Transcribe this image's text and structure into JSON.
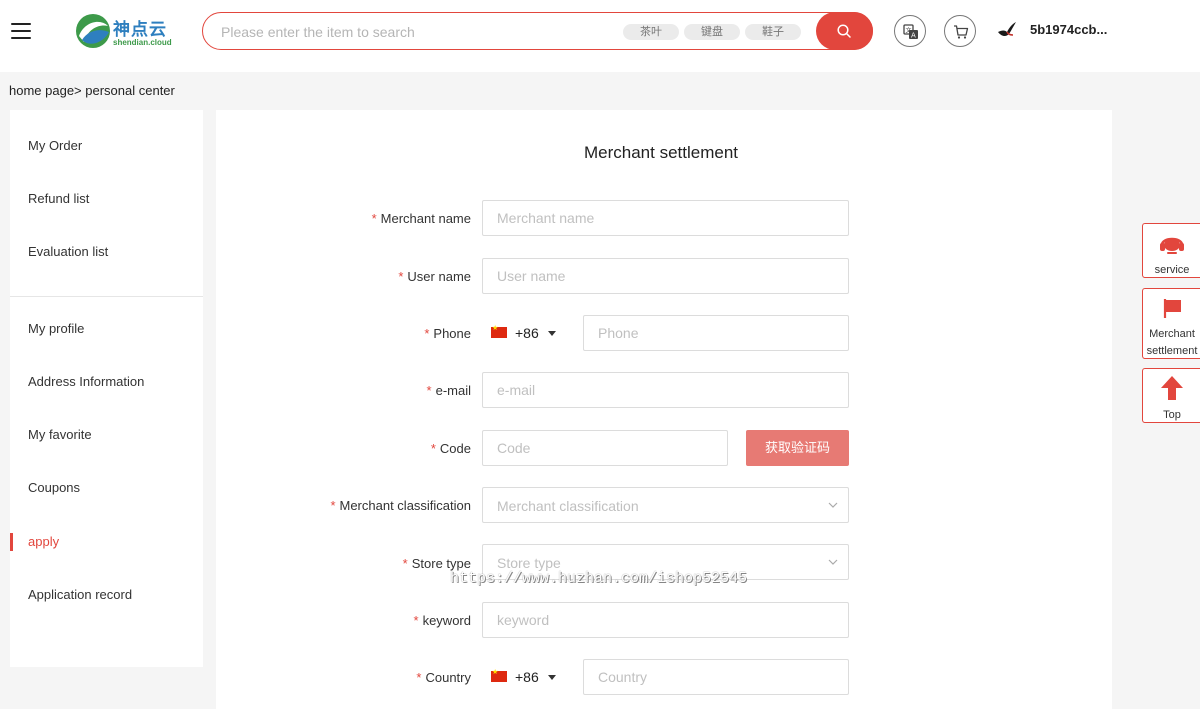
{
  "header": {
    "logo_cn": "神点云",
    "logo_en": "shendian.cloud",
    "search_placeholder": "Please enter the item to search",
    "tags": [
      "茶叶",
      "键盘",
      "鞋子"
    ],
    "username": "5b1974ccb..."
  },
  "breadcrumb": "home page> personal center",
  "sidebar": {
    "items": [
      {
        "label": "My Order"
      },
      {
        "label": "Refund list"
      },
      {
        "label": "Evaluation list"
      },
      {
        "label": "My profile"
      },
      {
        "label": "Address Information"
      },
      {
        "label": "My favorite"
      },
      {
        "label": "Coupons"
      },
      {
        "label": "apply",
        "active": true
      },
      {
        "label": "Application record"
      }
    ]
  },
  "form": {
    "title": "Merchant settlement",
    "required_mark": "*",
    "fields": [
      {
        "label": "Merchant name",
        "placeholder": "Merchant name"
      },
      {
        "label": "User name",
        "placeholder": "User name"
      },
      {
        "label": "Phone",
        "placeholder": "Phone",
        "prefix": "+86"
      },
      {
        "label": "e-mail",
        "placeholder": "e-mail"
      },
      {
        "label": "Code",
        "placeholder": "Code"
      },
      {
        "label": "Merchant classification",
        "placeholder": "Merchant classification"
      },
      {
        "label": "Store type",
        "placeholder": "Store type"
      },
      {
        "label": "keyword",
        "placeholder": "keyword"
      },
      {
        "label": "Country",
        "placeholder": "Country",
        "prefix": "+86"
      }
    ],
    "code_button": "获取验证码"
  },
  "watermark": "https://www.huzhan.com/ishop52545",
  "float": {
    "service": "service",
    "merchant_line1": "Merchant",
    "merchant_line2": "settlement",
    "top": "Top"
  },
  "colors": {
    "accent": "#e2463d",
    "code_button": "#e77a74"
  },
  "icons": {
    "menu": "hamburger-icon",
    "search": "search-icon",
    "translate": "translate-icon",
    "cart": "cart-icon",
    "user": "bird-avatar-icon",
    "service": "headset-icon",
    "merchant": "flag-icon",
    "top": "arrow-up-icon"
  }
}
